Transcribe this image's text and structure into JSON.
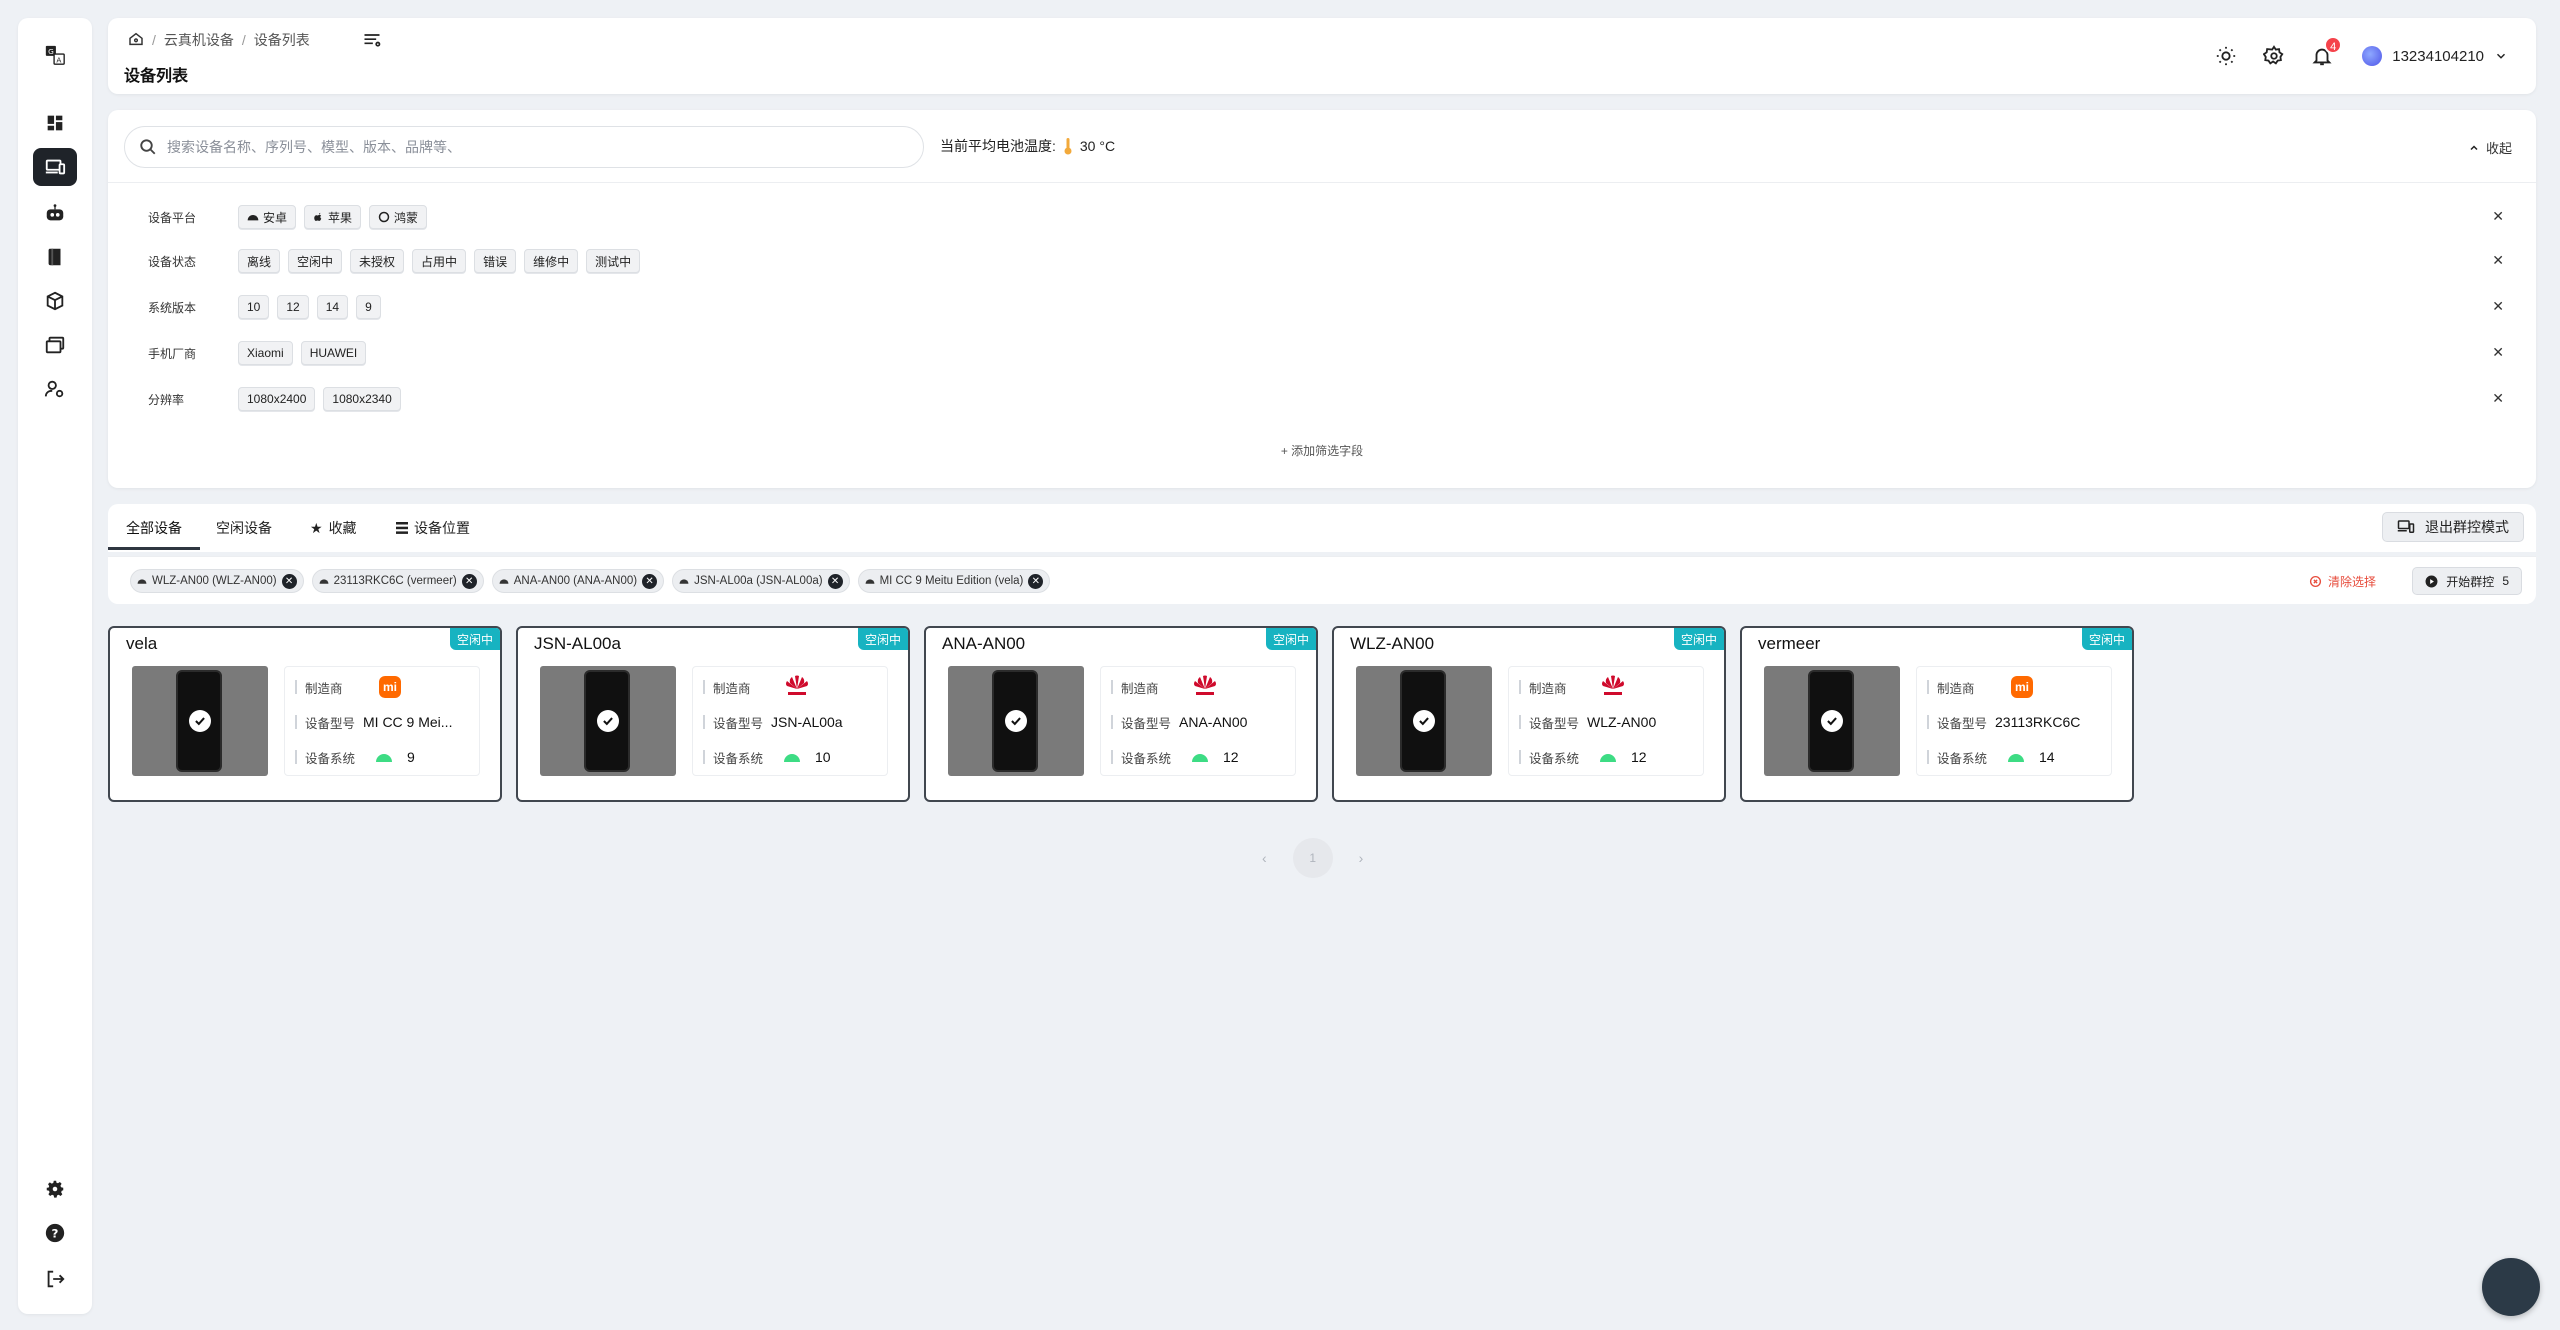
{
  "sidebar": {
    "items": [
      {
        "name": "logo-translate-icon"
      },
      {
        "name": "dashboard-icon"
      },
      {
        "name": "devices-icon",
        "active": true
      },
      {
        "name": "robot-icon"
      },
      {
        "name": "book-icon"
      },
      {
        "name": "package-icon"
      },
      {
        "name": "gallery-icon"
      },
      {
        "name": "user-settings-icon"
      }
    ],
    "bottom": [
      "settings-icon",
      "help-icon",
      "logout-icon"
    ]
  },
  "header": {
    "breadcrumb": [
      "云真机设备",
      "设备列表"
    ],
    "breadcrumb_sep": "/",
    "title": "设备列表",
    "notification_count": "4",
    "username": "13234104210"
  },
  "filter": {
    "search_placeholder": "搜索设备名称、序列号、模型、版本、品牌等、",
    "temp_label": "当前平均电池温度:",
    "temp_value": "30 °C",
    "collapse_label": "收起",
    "rows": [
      {
        "label": "设备平台",
        "chips": [
          "安卓",
          "苹果",
          "鸿蒙"
        ]
      },
      {
        "label": "设备状态",
        "chips": [
          "离线",
          "空闲中",
          "未授权",
          "占用中",
          "错误",
          "维修中",
          "测试中"
        ]
      },
      {
        "label": "系统版本",
        "chips": [
          "10",
          "12",
          "14",
          "9"
        ]
      },
      {
        "label": "手机厂商",
        "chips": [
          "Xiaomi",
          "HUAWEI"
        ]
      },
      {
        "label": "分辨率",
        "chips": [
          "1080x2400",
          "1080x2340"
        ]
      }
    ],
    "add_field_label": "添加筛选字段"
  },
  "tabs": {
    "all": "全部设备",
    "idle": "空闲设备",
    "favorites": "收藏",
    "location": "设备位置",
    "exit_group": "退出群控模式"
  },
  "selection": {
    "chips": [
      "WLZ-AN00 (WLZ-AN00)",
      "23113RKC6C (vermeer)",
      "ANA-AN00 (ANA-AN00)",
      "JSN-AL00a (JSN-AL00a)",
      "MI CC 9 Meitu Edition (vela)"
    ],
    "clear_label": "清除选择",
    "start_label": "开始群控",
    "start_count": "5"
  },
  "card_labels": {
    "maker": "制造商",
    "model": "设备型号",
    "os": "设备系统"
  },
  "devices": [
    {
      "name": "vela",
      "status": "空闲中",
      "maker": "xiaomi",
      "model": "MI CC 9 Mei...",
      "os": "9"
    },
    {
      "name": "JSN-AL00a",
      "status": "空闲中",
      "maker": "huawei",
      "model": "JSN-AL00a",
      "os": "10"
    },
    {
      "name": "ANA-AN00",
      "status": "空闲中",
      "maker": "huawei",
      "model": "ANA-AN00",
      "os": "12"
    },
    {
      "name": "WLZ-AN00",
      "status": "空闲中",
      "maker": "huawei",
      "model": "WLZ-AN00",
      "os": "12"
    },
    {
      "name": "vermeer",
      "status": "空闲中",
      "maker": "xiaomi",
      "model": "23113RKC6C",
      "os": "14"
    }
  ],
  "pagination": {
    "current": "1"
  },
  "colors": {
    "status": "#17b3c1",
    "xiaomi": "#ff6900",
    "huawei": "#cf0a2c",
    "android": "#3ddc84",
    "danger": "#e74c3c"
  }
}
